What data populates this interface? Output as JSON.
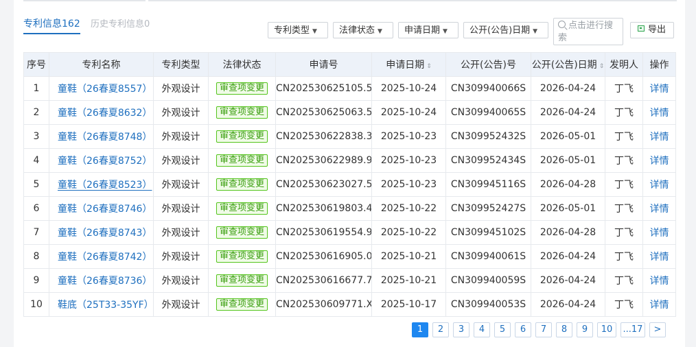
{
  "tabs": {
    "active_label": "专利信息",
    "active_count": "162",
    "history_label": "历史专利信息",
    "history_count": "0"
  },
  "filters": {
    "patent_type": "专利类型",
    "legal_status": "法律状态",
    "apply_date": "申请日期",
    "publish_date": "公开(公告)日期",
    "search_placeholder": "点击进行搜索",
    "export": "导出"
  },
  "table": {
    "headers": [
      "序号",
      "专利名称",
      "专利类型",
      "法律状态",
      "申请号",
      "申请日期",
      "公开(公告)号",
      "公开(公告)日期",
      "发明人",
      "操作"
    ],
    "rows": [
      {
        "idx": "1",
        "name": "童鞋（26春夏8557）",
        "type": "外观设计",
        "status": "审查项变更",
        "app_no": "CN202530625105.5",
        "app_date": "2025-10-24",
        "pub_no": "CN309940066S",
        "pub_date": "2026-04-24",
        "inventor": "丁飞",
        "action": "详情"
      },
      {
        "idx": "2",
        "name": "童鞋（26春夏8632）",
        "type": "外观设计",
        "status": "审查项变更",
        "app_no": "CN202530625063.5",
        "app_date": "2025-10-24",
        "pub_no": "CN309940065S",
        "pub_date": "2026-04-24",
        "inventor": "丁飞",
        "action": "详情"
      },
      {
        "idx": "3",
        "name": "童鞋（26春夏8748）",
        "type": "外观设计",
        "status": "审查项变更",
        "app_no": "CN202530622838.3",
        "app_date": "2025-10-23",
        "pub_no": "CN309952432S",
        "pub_date": "2026-05-01",
        "inventor": "丁飞",
        "action": "详情"
      },
      {
        "idx": "4",
        "name": "童鞋（26春夏8752）",
        "type": "外观设计",
        "status": "审查项变更",
        "app_no": "CN202530622989.9",
        "app_date": "2025-10-23",
        "pub_no": "CN309952434S",
        "pub_date": "2026-05-01",
        "inventor": "丁飞",
        "action": "详情"
      },
      {
        "idx": "5",
        "name": "童鞋（26春夏8523）",
        "type": "外观设计",
        "status": "审查项变更",
        "app_no": "CN202530623027.5",
        "app_date": "2025-10-23",
        "pub_no": "CN309945116S",
        "pub_date": "2026-04-28",
        "inventor": "丁飞",
        "action": "详情"
      },
      {
        "idx": "6",
        "name": "童鞋（26春夏8746）",
        "type": "外观设计",
        "status": "审查项变更",
        "app_no": "CN202530619803.4",
        "app_date": "2025-10-22",
        "pub_no": "CN309952427S",
        "pub_date": "2026-05-01",
        "inventor": "丁飞",
        "action": "详情"
      },
      {
        "idx": "7",
        "name": "童鞋（26春夏8743）",
        "type": "外观设计",
        "status": "审查项变更",
        "app_no": "CN202530619554.9",
        "app_date": "2025-10-22",
        "pub_no": "CN309945102S",
        "pub_date": "2026-04-28",
        "inventor": "丁飞",
        "action": "详情"
      },
      {
        "idx": "8",
        "name": "童鞋（26春夏8742）",
        "type": "外观设计",
        "status": "审查项变更",
        "app_no": "CN202530616905.0",
        "app_date": "2025-10-21",
        "pub_no": "CN309940061S",
        "pub_date": "2026-04-24",
        "inventor": "丁飞",
        "action": "详情"
      },
      {
        "idx": "9",
        "name": "童鞋（26春夏8736）",
        "type": "外观设计",
        "status": "审查项变更",
        "app_no": "CN202530616677.7",
        "app_date": "2025-10-21",
        "pub_no": "CN309940059S",
        "pub_date": "2026-04-24",
        "inventor": "丁飞",
        "action": "详情"
      },
      {
        "idx": "10",
        "name": "鞋底（25T33-35YF）",
        "type": "外观设计",
        "status": "审查项变更",
        "app_no": "CN202530609771.X",
        "app_date": "2025-10-17",
        "pub_no": "CN309940053S",
        "pub_date": "2026-04-24",
        "inventor": "丁飞",
        "action": "详情"
      }
    ]
  },
  "pager": {
    "pages": [
      "1",
      "2",
      "3",
      "4",
      "5",
      "6",
      "7",
      "8",
      "9",
      "10",
      "...17"
    ],
    "current": "1",
    "next_icon": "chevron-right-icon"
  },
  "colors": {
    "link": "#1e6fbf",
    "status_green": "#52c41a",
    "pager_active": "#1e87f0",
    "header_bg": "#edf2f9"
  }
}
